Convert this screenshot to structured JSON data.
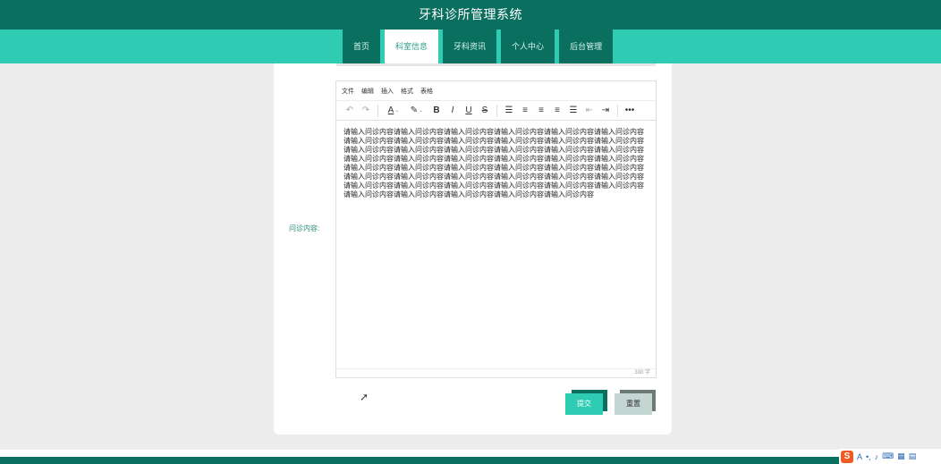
{
  "header": {
    "title": "牙科诊所管理系统"
  },
  "nav": {
    "tabs": [
      {
        "label": "首页"
      },
      {
        "label": "科室信息"
      },
      {
        "label": "牙科资讯"
      },
      {
        "label": "个人中心"
      },
      {
        "label": "后台管理"
      }
    ],
    "active_index": 1
  },
  "form": {
    "field_label": "问诊内容:",
    "editor": {
      "menu": [
        "文件",
        "编辑",
        "插入",
        "格式",
        "表格"
      ],
      "content": "请输入问诊内容请输入问诊内容请输入问诊内容请输入问诊内容请输入问诊内容请输入问诊内容请输入问诊内容请输入问诊内容请输入问诊内容请输入问诊内容请输入问诊内容请输入问诊内容请输入问诊内容请输入问诊内容请输入问诊内容请输入问诊内容请输入问诊内容请输入问诊内容请输入问诊内容请输入问诊内容请输入问诊内容请输入问诊内容请输入问诊内容请输入问诊内容请输入问诊内容请输入问诊内容请输入问诊内容请输入问诊内容请输入问诊内容请输入问诊内容请输入问诊内容请输入问诊内容请输入问诊内容请输入问诊内容请输入问诊内容请输入问诊内容请输入问诊内容请输入问诊内容请输入问诊内容请输入问诊内容请输入问诊内容请输入问诊内容请输入问诊内容请输入问诊内容请输入问诊内容请输入问诊内容请输入问诊内容",
      "word_count": "330 字"
    },
    "submit_label": "提交",
    "reset_label": "重置"
  },
  "ime": {
    "logo": "S",
    "mode": "A"
  },
  "colors": {
    "primary_dark": "#0b6f5f",
    "primary_light": "#2ecdb3"
  }
}
